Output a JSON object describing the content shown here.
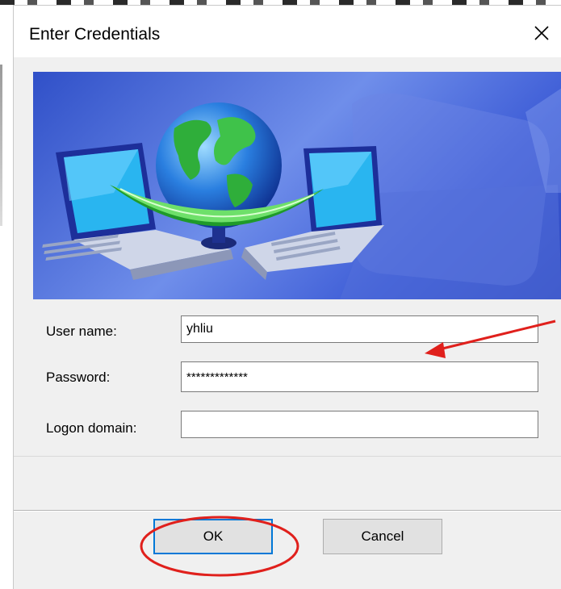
{
  "dialog": {
    "title": "Enter Credentials",
    "close_glyph": "✕"
  },
  "banner": {
    "icon": "network-globe-laptops-illustration"
  },
  "form": {
    "username_label": "User name:",
    "username_value": "yhliu",
    "password_label": "Password:",
    "password_value": "*************",
    "domain_label": "Logon domain:",
    "domain_value": ""
  },
  "buttons": {
    "ok_label": "OK",
    "cancel_label": "Cancel"
  },
  "annotations": {
    "arrow_color": "#e0201c",
    "circle_color": "#e0201c"
  }
}
